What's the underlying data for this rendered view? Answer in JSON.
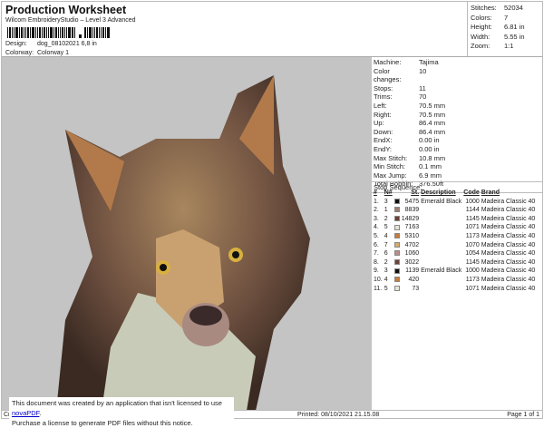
{
  "header": {
    "title": "Production Worksheet",
    "software": "Wilcom EmbroideryStudio – Level 3 Advanced",
    "design_label": "Design:",
    "design": "dog_08102021 6,8 in",
    "colorway_label": "Colorway:",
    "colorway": "Colorway 1"
  },
  "stats": [
    {
      "k": "Stitches:",
      "v": "52034"
    },
    {
      "k": "Colors:",
      "v": "7"
    },
    {
      "k": "Height:",
      "v": "6.81 in"
    },
    {
      "k": "Width:",
      "v": "5.55 in"
    },
    {
      "k": "Zoom:",
      "v": "1:1"
    }
  ],
  "info": [
    {
      "k": "Machine:",
      "v": "Tajima"
    },
    {
      "k": "Color changes:",
      "v": "10"
    },
    {
      "k": "Stops:",
      "v": "11"
    },
    {
      "k": "Trims:",
      "v": "70"
    },
    {
      "k": "Left:",
      "v": "70.5 mm"
    },
    {
      "k": "Right:",
      "v": "70.5 mm"
    },
    {
      "k": "Up:",
      "v": "86.4 mm"
    },
    {
      "k": "Down:",
      "v": "86.4 mm"
    },
    {
      "k": "EndX:",
      "v": "0.00 in"
    },
    {
      "k": "EndY:",
      "v": "0.00 in"
    },
    {
      "k": "Max Stitch:",
      "v": "10.8 mm"
    },
    {
      "k": "Min Stitch:",
      "v": "0.1 mm"
    },
    {
      "k": "Max Jump:",
      "v": "6.9 mm"
    },
    {
      "k": "Total Bobbin:",
      "v": "376.50ft"
    }
  ],
  "stop_sequence": {
    "title": "Stop Sequence:",
    "columns": [
      "#",
      "N#",
      "St.",
      "Description",
      "Code",
      "Brand"
    ],
    "rows": [
      {
        "n": "1.",
        "nn": "3",
        "color": "#111111",
        "st": "5475",
        "desc": "Emerald Black",
        "code": "1000",
        "brand": "Madeira Classic 40"
      },
      {
        "n": "2.",
        "nn": "1",
        "color": "#9c7f6e",
        "st": "8839",
        "desc": "",
        "code": "1144",
        "brand": "Madeira Classic 40"
      },
      {
        "n": "3.",
        "nn": "2",
        "color": "#6a4236",
        "st": "14829",
        "desc": "",
        "code": "1145",
        "brand": "Madeira Classic 40"
      },
      {
        "n": "4.",
        "nn": "5",
        "color": "#e6e2d6",
        "st": "7163",
        "desc": "",
        "code": "1071",
        "brand": "Madeira Classic 40"
      },
      {
        "n": "5.",
        "nn": "4",
        "color": "#c97a38",
        "st": "5310",
        "desc": "",
        "code": "1173",
        "brand": "Madeira Classic 40"
      },
      {
        "n": "6.",
        "nn": "7",
        "color": "#d9aa6c",
        "st": "4702",
        "desc": "",
        "code": "1070",
        "brand": "Madeira Classic 40"
      },
      {
        "n": "7.",
        "nn": "6",
        "color": "#b88f88",
        "st": "1060",
        "desc": "",
        "code": "1054",
        "brand": "Madeira Classic 40"
      },
      {
        "n": "8.",
        "nn": "2",
        "color": "#6a4236",
        "st": "3022",
        "desc": "",
        "code": "1145",
        "brand": "Madeira Classic 40"
      },
      {
        "n": "9.",
        "nn": "3",
        "color": "#111111",
        "st": "1139",
        "desc": "Emerald Black",
        "code": "1000",
        "brand": "Madeira Classic 40"
      },
      {
        "n": "10.",
        "nn": "4",
        "color": "#c97a38",
        "st": "420",
        "desc": "",
        "code": "1173",
        "brand": "Madeira Classic 40"
      },
      {
        "n": "11.",
        "nn": "5",
        "color": "#e6e2d6",
        "st": "73",
        "desc": "",
        "code": "1071",
        "brand": "Madeira Classic 40"
      }
    ]
  },
  "footer": {
    "left": "Cr",
    "printed": "Printed: 08/10/2021 21.15.08",
    "page": "Page 1 of 1"
  },
  "notice": {
    "line1": "This document was created by an application that isn't licensed to use ",
    "link": "novaPDF",
    "line1_end": ".",
    "line2": "Purchase a license to generate PDF files without this notice."
  }
}
